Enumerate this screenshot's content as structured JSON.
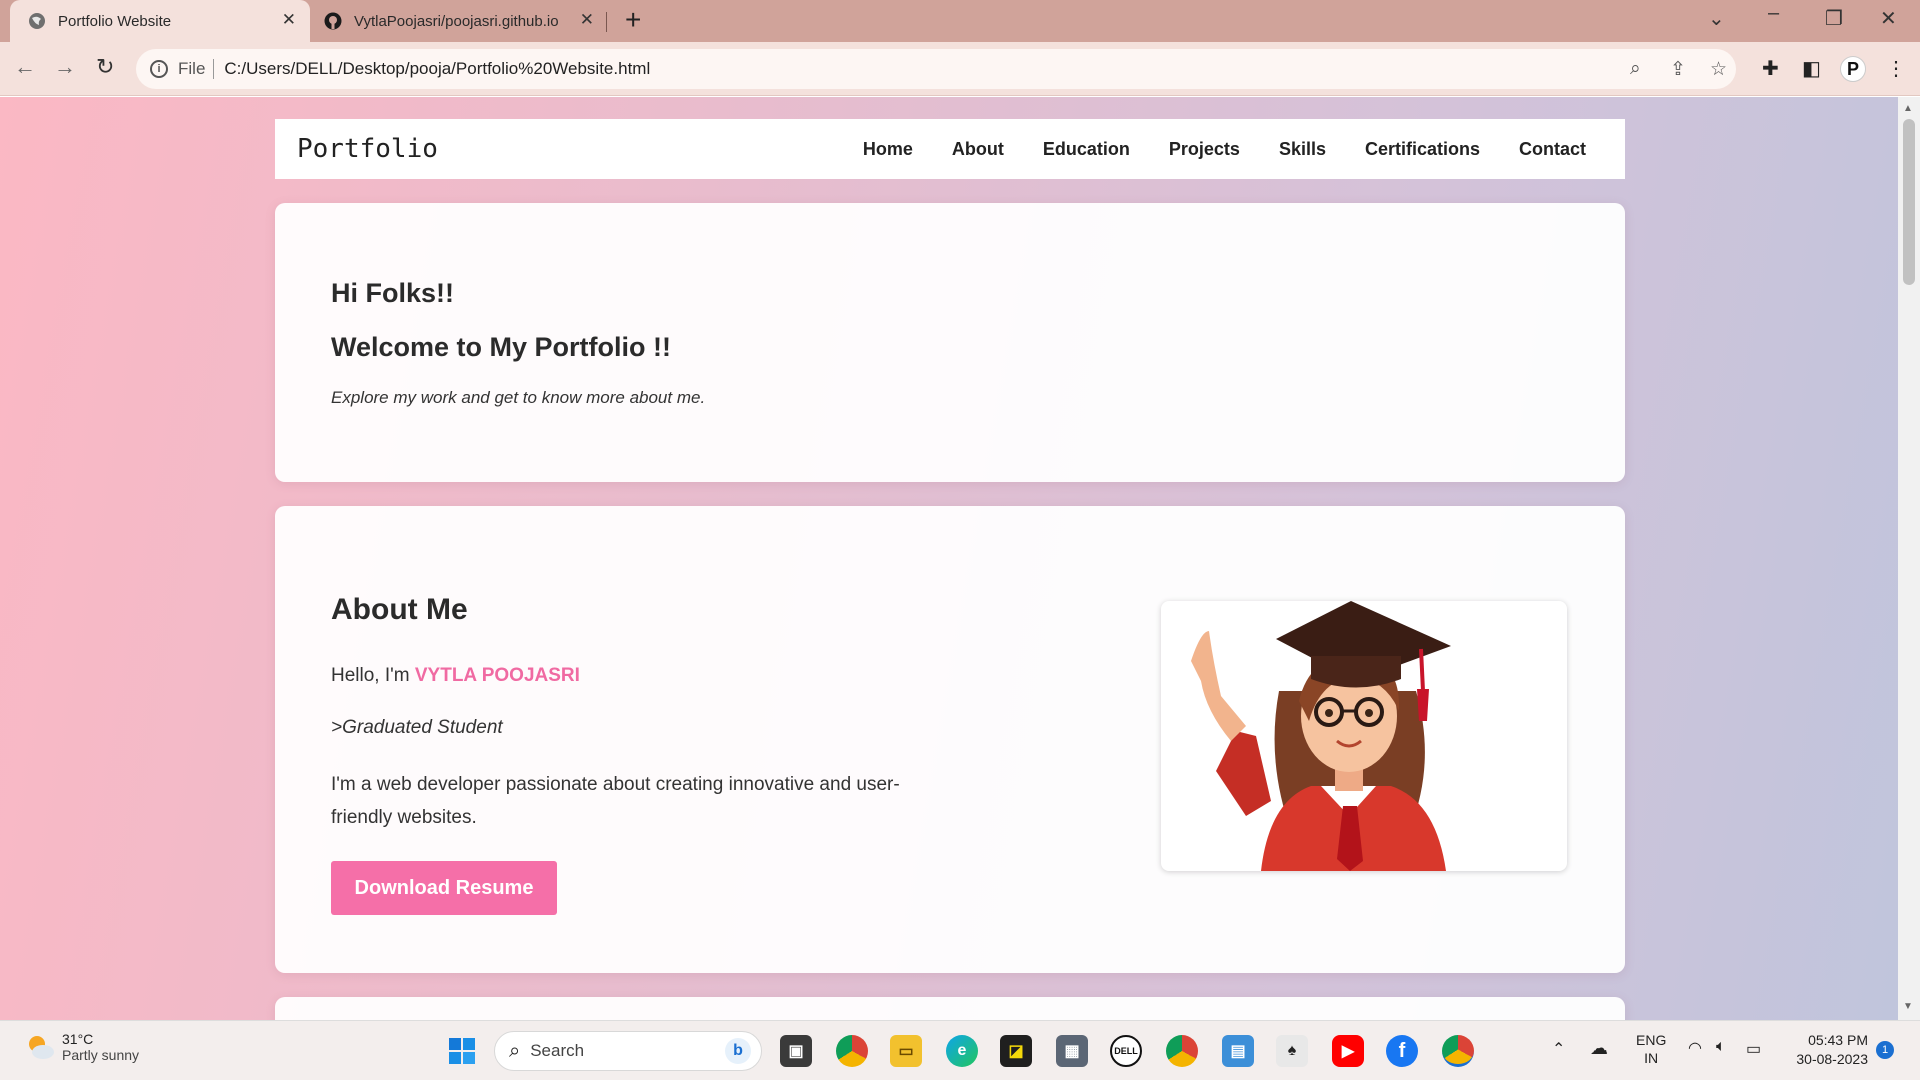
{
  "browser": {
    "tabs": [
      {
        "title": "Portfolio Website",
        "active": true,
        "icon": "globe-icon"
      },
      {
        "title": "VytlaPoojasri/poojasri.github.io",
        "active": false,
        "icon": "github-icon"
      }
    ],
    "address": {
      "scheme_label": "File",
      "url": "C:/Users/DELL/Desktop/pooja/Portfolio%20Website.html"
    },
    "profile_initial": "P"
  },
  "site": {
    "logo": "Portfolio",
    "nav": [
      "Home",
      "About",
      "Education",
      "Projects",
      "Skills",
      "Certifications",
      "Contact"
    ],
    "hero": {
      "greeting": "Hi Folks!!",
      "welcome": "Welcome to My Portfolio !!",
      "tagline": "Explore my work and get to know more about me."
    },
    "about": {
      "heading": "About Me",
      "hello_prefix": "Hello, I'm ",
      "name": "VYTLA POOJASRI",
      "role": ">Graduated Student",
      "bio": "I'm a web developer passionate about creating innovative and user-friendly websites.",
      "button": "Download Resume"
    },
    "accent_color": "#f56fa8"
  },
  "taskbar": {
    "weather": {
      "temp": "31°C",
      "condition": "Partly sunny"
    },
    "search_placeholder": "Search",
    "language": {
      "line1": "ENG",
      "line2": "IN"
    },
    "clock": {
      "time": "05:43 PM",
      "date": "30-08-2023"
    },
    "notification_count": "1"
  }
}
